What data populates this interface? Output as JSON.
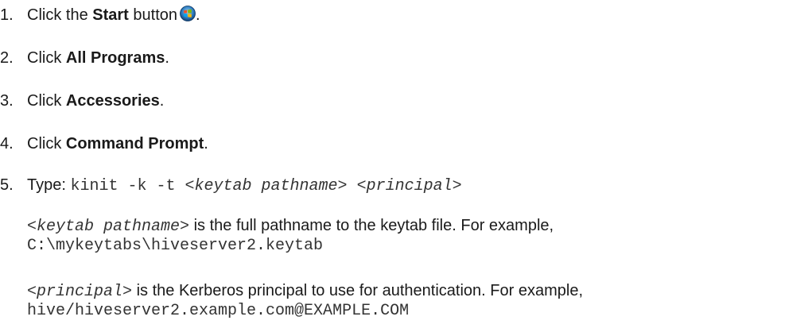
{
  "steps": [
    {
      "num": "1.",
      "prefix": "Click the ",
      "bold": "Start",
      "suffix": " button",
      "icon": "windows-start-orb-icon",
      "after_icon": "."
    },
    {
      "num": "2.",
      "prefix": "Click ",
      "bold": "All Programs",
      "suffix": "."
    },
    {
      "num": "3.",
      "prefix": "Click ",
      "bold": "Accessories",
      "suffix": "."
    },
    {
      "num": "4.",
      "prefix": "Click ",
      "bold": "Command Prompt",
      "suffix": "."
    },
    {
      "num": "5.",
      "prefix": "Type: ",
      "code": "kinit -k -t ",
      "arg1": "<keytab pathname>",
      "sep": " ",
      "arg2": "<principal>"
    }
  ],
  "keytab_note": {
    "term": "<keytab pathname>",
    "text": " is the full pathname to the keytab file. For example,",
    "example": "C:\\mykeytabs\\hiveserver2.keytab"
  },
  "principal_note": {
    "term": "<principal>",
    "text": " is the Kerberos principal to use for authentication. For example,",
    "example": "hive/hiveserver2.example.com@EXAMPLE.COM"
  }
}
